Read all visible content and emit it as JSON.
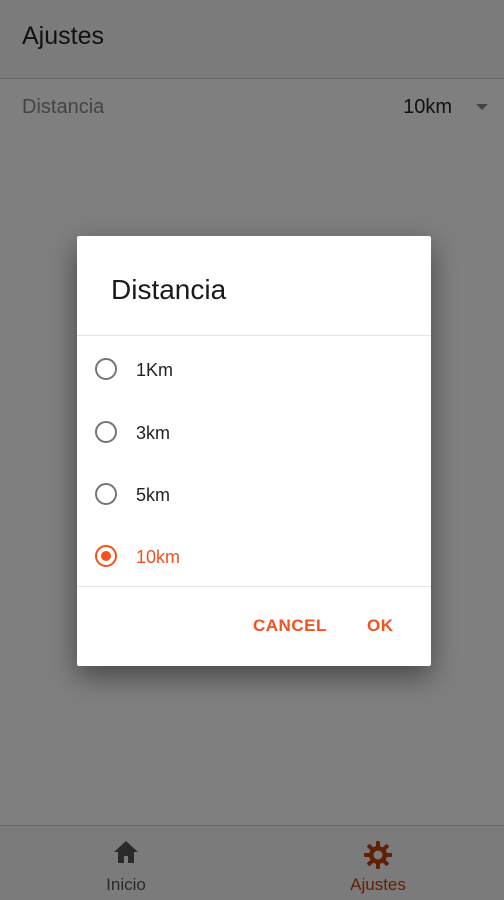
{
  "header": {
    "title": "Ajustes"
  },
  "setting": {
    "label": "Distancia",
    "value": "10km"
  },
  "bottom_nav": {
    "items": [
      {
        "label": "Inicio",
        "icon": "home-icon"
      },
      {
        "label": "Ajustes",
        "icon": "gear-icon"
      }
    ],
    "active_index": 1
  },
  "dialog": {
    "title": "Distancia",
    "options": [
      {
        "label": "1Km",
        "selected": false
      },
      {
        "label": "3km",
        "selected": false
      },
      {
        "label": "5km",
        "selected": false
      },
      {
        "label": "10km",
        "selected": true
      }
    ],
    "cancel_label": "CANCEL",
    "ok_label": "OK"
  },
  "colors": {
    "accent": "#f4511e",
    "nav_active": "#c2410c",
    "scrim": "rgba(0,0,0,0.5)"
  }
}
